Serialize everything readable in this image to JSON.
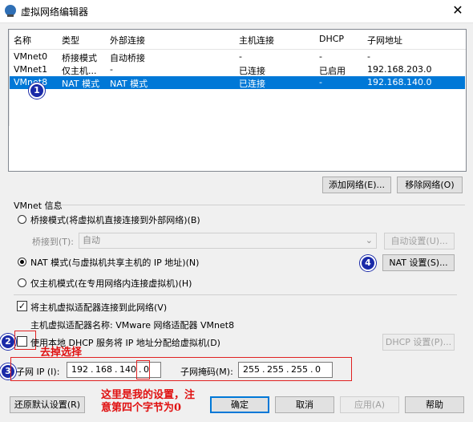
{
  "window": {
    "title": "虚拟网络编辑器",
    "close_glyph": "✕"
  },
  "table": {
    "columns": [
      "名称",
      "类型",
      "外部连接",
      "主机连接",
      "DHCP",
      "子网地址"
    ],
    "rows": [
      [
        "VMnet0",
        "桥接模式",
        "自动桥接",
        "-",
        "-",
        "-"
      ],
      [
        "VMnet1",
        "仅主机...",
        "-",
        "已连接",
        "已启用",
        "192.168.203.0"
      ],
      [
        "VMnet8",
        "NAT 模式",
        "NAT 模式",
        "已连接",
        "-",
        "192.168.140.0"
      ]
    ],
    "selected_row": 2
  },
  "buttons": {
    "add_network": "添加网络(E)...",
    "remove_network": "移除网络(O)",
    "auto_settings": "自动设置(U)...",
    "nat_settings": "NAT 设置(S)...",
    "dhcp_settings": "DHCP 设置(P)...",
    "restore_defaults": "还原默认设置(R)",
    "ok": "确定",
    "cancel": "取消",
    "apply": "应用(A)",
    "help": "帮助"
  },
  "vmnet_info": {
    "title": "VMnet 信息",
    "bridged": "桥接模式(将虚拟机直接连接到外部网络)(B)",
    "bridged_to_label": "桥接到(T):",
    "bridged_to_value": "自动",
    "nat": "NAT 模式(与虚拟机共享主机的 IP 地址)(N)",
    "host_only": "仅主机模式(在专用网络内连接虚拟机)(H)",
    "selected_mode": "nat",
    "connect_adapter": "将主机虚拟适配器连接到此网络(V)",
    "connect_adapter_checked": true,
    "adapter_name_label": "主机虚拟适配器名称: VMware 网络适配器 VMnet8",
    "use_dhcp": "使用本地 DHCP 服务将 IP 地址分配给虚拟机(D)",
    "use_dhcp_checked": false,
    "subnet_ip_label": "子网 IP (I):",
    "subnet_ip": [
      "192",
      "168",
      "140",
      "0"
    ],
    "subnet_mask_label": "子网掩码(M):",
    "subnet_mask": [
      "255",
      "255",
      "255",
      "0"
    ]
  },
  "annotations": {
    "markers": [
      "1",
      "2",
      "3",
      "4"
    ],
    "remove_selection": "去掉选择",
    "note_line1": "这里是我的设置，注",
    "note_line2": "意第四个字节为0",
    "colors": {
      "marker": "#1a2aa8",
      "note": "#e01010",
      "selection": "#0078d7"
    }
  }
}
